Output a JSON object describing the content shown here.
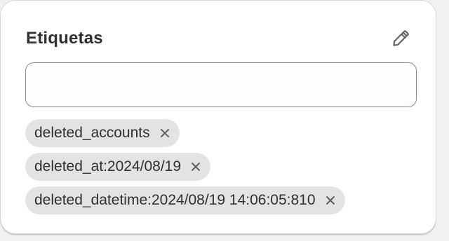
{
  "card": {
    "title": "Etiquetas",
    "edit_icon": "pencil-icon"
  },
  "tag_input": {
    "value": "",
    "placeholder": ""
  },
  "tags": [
    {
      "label": "deleted_accounts",
      "remove_icon": "close-icon"
    },
    {
      "label": "deleted_at:2024/08/19",
      "remove_icon": "close-icon"
    },
    {
      "label": "deleted_datetime:2024/08/19 14:06:05:810",
      "remove_icon": "close-icon"
    }
  ],
  "colors": {
    "card_background": "#ffffff",
    "tag_background": "#e3e3e3",
    "text": "#303030",
    "icon": "#616161",
    "input_border": "#8a8a8a"
  }
}
